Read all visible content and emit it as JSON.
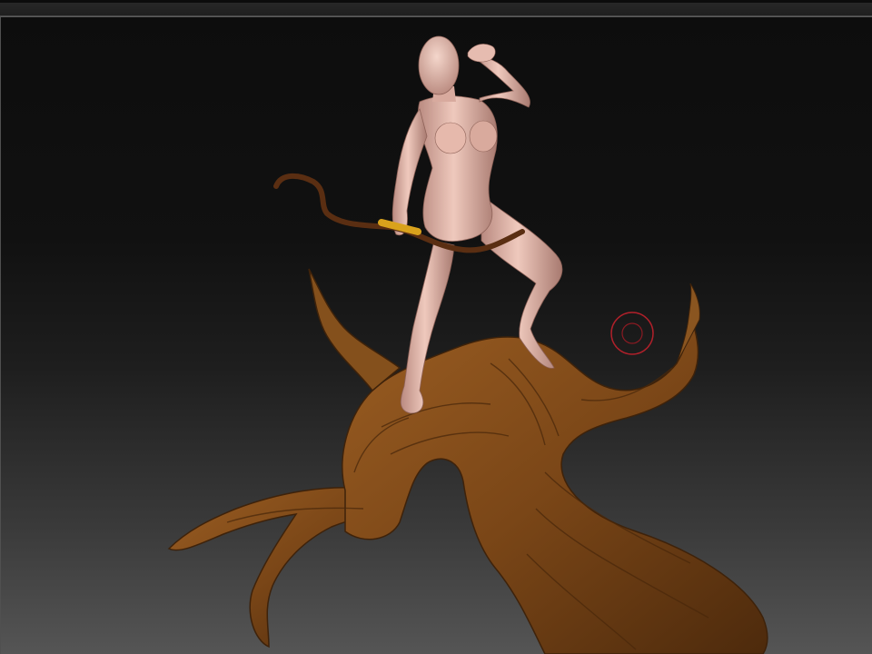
{
  "app": {
    "viewport_background": {
      "top": "#0d0d0d",
      "bottom": "#555555"
    }
  },
  "scene": {
    "subject": "figure-with-bow-on-tree-stump",
    "materials": {
      "figure_skin": "#e3b7aa",
      "tree_bark": "#7a4617",
      "bow": "#5a2e12",
      "bow_grip": "#d9a21c"
    }
  },
  "cursor": {
    "icon": "brush-cursor-icon",
    "color": "#b0202a"
  }
}
